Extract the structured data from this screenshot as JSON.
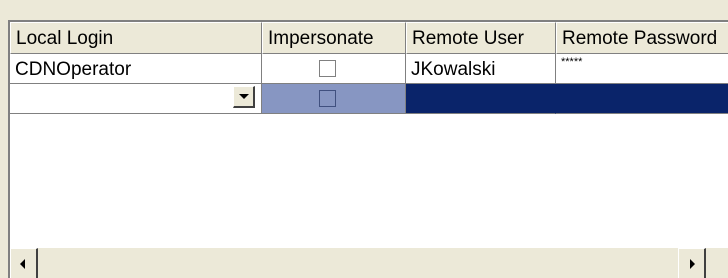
{
  "columns": [
    "Local Login",
    "Impersonate",
    "Remote User",
    "Remote Password"
  ],
  "rows": [
    {
      "local_login": "CDNOperator",
      "impersonate": false,
      "remote_user": "JKowalski",
      "remote_password": "*****"
    },
    {
      "local_login": "",
      "impersonate": false,
      "remote_user": "",
      "remote_password": ""
    }
  ],
  "colors": {
    "selection_light": "#8796c2",
    "selection_dark": "#0a246a",
    "face": "#ece9d8"
  },
  "icons": {
    "combo": "chevron-down-icon",
    "scroll_left": "arrow-left-icon",
    "scroll_right": "arrow-right-icon"
  }
}
